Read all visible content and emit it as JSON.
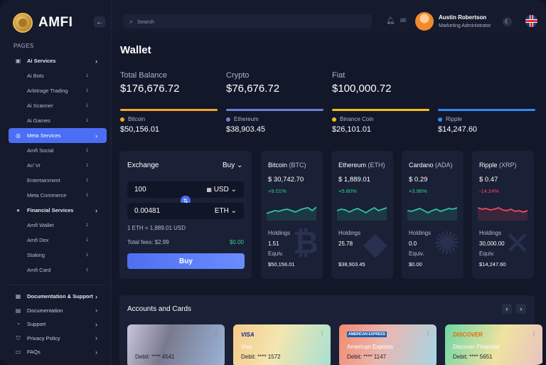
{
  "app": {
    "name": "AMFI",
    "collapse_icon": "arrow-left-icon"
  },
  "sidebar": {
    "section_label": "PAGES",
    "items": [
      {
        "label": "Ai Services",
        "type": "group",
        "icon": "robot-icon",
        "chevron": "›"
      },
      {
        "label": "Ai Bots",
        "type": "sub",
        "count": "1"
      },
      {
        "label": "Arbitrage Trading",
        "type": "sub",
        "count": "1"
      },
      {
        "label": "Ai Scanner",
        "type": "sub",
        "count": "1"
      },
      {
        "label": "Ai Games",
        "type": "sub",
        "count": "1"
      },
      {
        "label": "Meta Services",
        "type": "active",
        "icon": "globe-icon",
        "chevron": "›"
      },
      {
        "label": "Amfi Social",
        "type": "sub",
        "count": "1"
      },
      {
        "label": "Ar/ Vr",
        "type": "sub",
        "count": "1"
      },
      {
        "label": "Entertainment",
        "type": "sub",
        "count": "1"
      },
      {
        "label": "Meta Commerce",
        "type": "sub",
        "count": "1"
      },
      {
        "label": "Financial Services",
        "type": "group",
        "icon": "money-bag-icon",
        "chevron": "›"
      },
      {
        "label": "Amfi Wallet",
        "type": "sub",
        "count": "1"
      },
      {
        "label": "Amfi Dex",
        "type": "sub",
        "count": "1"
      },
      {
        "label": "Staking",
        "type": "sub",
        "count": "1"
      },
      {
        "label": "Amfi Card",
        "type": "sub",
        "count": "1"
      }
    ],
    "bottom_items": [
      {
        "label": "Documentation & Support",
        "type": "group",
        "icon": "grid-icon",
        "chevron": "›"
      },
      {
        "label": "Documentation",
        "type": "plain",
        "icon": "document-icon",
        "chevron": "›"
      },
      {
        "label": "Support",
        "type": "plain",
        "icon": "headset-icon",
        "chevron": "›"
      },
      {
        "label": "Privacy Policy",
        "type": "plain",
        "icon": "shield-icon",
        "chevron": "›"
      },
      {
        "label": "FAQs",
        "type": "plain",
        "icon": "faq-icon",
        "chevron": "›"
      }
    ]
  },
  "topbar": {
    "search_placeholder": "Search",
    "user_name": "Austin Robertson",
    "user_role": "Marketing Administrator",
    "language": "UK flag"
  },
  "wallet": {
    "title": "Wallet",
    "balances": [
      {
        "label": "Total Balance",
        "value": "$176,676.72"
      },
      {
        "label": "Crypto",
        "value": "$76,676.72"
      },
      {
        "label": "Fiat",
        "value": "$100,000.72"
      }
    ],
    "coins": [
      {
        "name": "Bitcoin",
        "value": "$50,156.01",
        "color": "#f5a623"
      },
      {
        "name": "Ethereum",
        "value": "$38,903.45",
        "color": "#6e7fd6"
      },
      {
        "name": "Binance Coin",
        "value": "$26,101.01",
        "color": "#f3c01a"
      },
      {
        "name": "Ripple",
        "value": "$14,247.60",
        "color": "#2e8bf0"
      }
    ]
  },
  "exchange": {
    "title": "Exchange",
    "mode": "Buy",
    "from_amount": "100",
    "from_currency": "USD",
    "to_amount": "0.00481",
    "to_currency": "ETH",
    "rate": "1 ETH = 1,889.01 USD",
    "fees_label": "Total fees: $2.99",
    "fees_value": "$0.00",
    "button": "Buy"
  },
  "crypto_cards": [
    {
      "name": "Bitcoin",
      "ticker": "(BTC)",
      "price": "$ 30,742.70",
      "change": "+9.01%",
      "up": true,
      "holdings_label": "Holdings",
      "holdings": "1.51",
      "equiv_label": "Equiv.",
      "equiv": "$50,156.01",
      "mark": "₿",
      "spark": [
        18,
        16,
        14,
        15,
        13,
        12,
        14,
        16,
        13,
        11,
        10,
        14,
        9
      ]
    },
    {
      "name": "Ethereum",
      "ticker": "(ETH)",
      "price": "$ 1,889.01",
      "change": "+5.80%",
      "up": true,
      "holdings_label": "Holdings",
      "holdings": "25.78",
      "equiv_label": "",
      "equiv": "$38,903.45",
      "mark": "◆",
      "spark": [
        14,
        12,
        13,
        16,
        13,
        11,
        14,
        17,
        13,
        10,
        14,
        12,
        10
      ]
    },
    {
      "name": "Cardano",
      "ticker": "(ADA)",
      "price": "$ 0.29",
      "change": "+3.96%",
      "up": true,
      "holdings_label": "Holdings",
      "holdings": "0.0",
      "equiv_label": "Equiv.",
      "equiv": "$0.00",
      "mark": "✺",
      "spark": [
        14,
        15,
        13,
        11,
        14,
        17,
        14,
        12,
        15,
        13,
        11,
        12,
        10
      ]
    },
    {
      "name": "Ripple",
      "ticker": "(XRP)",
      "price": "$ 0.47",
      "change": "-14.24%",
      "up": false,
      "holdings_label": "Holdings",
      "holdings": "30,000.00",
      "equiv_label": "Equiv.",
      "equiv": "$14,247.60",
      "mark": "✕",
      "spark": [
        10,
        12,
        11,
        13,
        12,
        10,
        13,
        14,
        12,
        15,
        14,
        16,
        14
      ]
    }
  ],
  "accounts": {
    "title": "Accounts and Cards",
    "cards": [
      {
        "brand": "",
        "name": "",
        "debit": "Debit: **** 4541"
      },
      {
        "brand": "VISA",
        "name": "Visa",
        "debit": "Debit: **** 1572"
      },
      {
        "brand": "AMERICAN EXPRESS",
        "name": "American Express",
        "debit": "Debit: **** 1147"
      },
      {
        "brand": "DISCOVER",
        "name": "Discover Financial",
        "debit": "Debit: **** 5651"
      }
    ]
  },
  "colors": {
    "accent": "#4b6ef5",
    "positive": "#2fd27f",
    "negative": "#ef4b5f"
  }
}
